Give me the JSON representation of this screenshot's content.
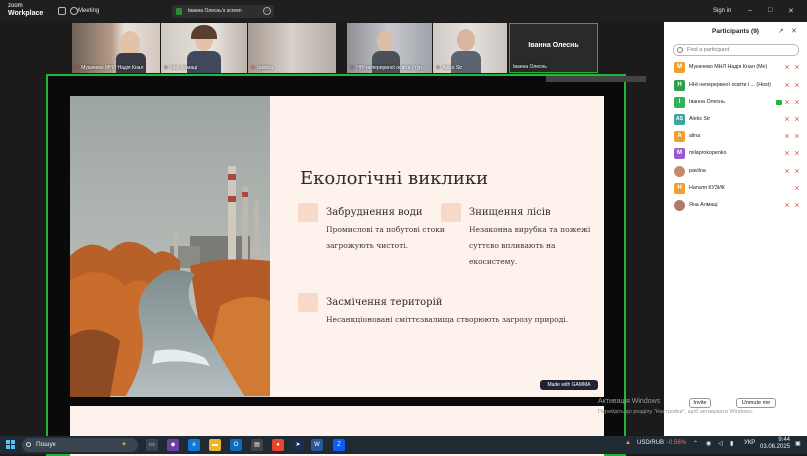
{
  "titlebar": {
    "logo_line1": "zoom",
    "logo_line2": "Workplace",
    "meeting_label": "Meeting",
    "screen_chip": "Іванна Олеснь's screen",
    "signin": "Sign in",
    "minimize": "–",
    "maximize": "□",
    "close": "✕"
  },
  "thumbnails": [
    {
      "name": "Мукачево МНЛ Надія Кнал"
    },
    {
      "name": "Яна Алмаці"
    },
    {
      "name": "pavlina"
    },
    {
      "name": "ННі неперервної освіти і тур..."
    },
    {
      "name": "Aleks Str"
    },
    {
      "name": "Іванна Олеснь",
      "active_label": "Іванна Олеснь"
    }
  ],
  "slide": {
    "title": "Екологічні виклики",
    "items": [
      {
        "head": "Забруднення води",
        "text1": "Промислові та побутові стоки",
        "text2": "загрожують чистоті."
      },
      {
        "head": "Знищення лісів",
        "text1": "Незаконна вирубка та пожежі",
        "text2": "суттєво впливають на",
        "text3": "екосистему."
      },
      {
        "head": "Засмічення територій",
        "text1": "Несанкціоновані сміттєзвалища створюють загрозу природі."
      }
    ],
    "made_with": "Made with GAMMA"
  },
  "panel": {
    "title": "Participants (9)",
    "search_placeholder": "Find a participant",
    "participants": [
      {
        "initial": "М",
        "name": "Мукачево МНЛ Надія Кнал (Me)",
        "color": "#f0a030"
      },
      {
        "initial": "Н",
        "name": "ННі неперервної освіти і ... (Host)",
        "color": "#2e9e4a"
      },
      {
        "initial": "І",
        "name": "Іванна Олеснь",
        "color": "#2fb35a"
      },
      {
        "initial": "AS",
        "name": "Aleks Str",
        "color": "#3aa6a0"
      },
      {
        "initial": "A",
        "name": "alina",
        "color": "#f0a030"
      },
      {
        "initial": "M",
        "name": "milaprokopenko",
        "color": "#9a5bd0"
      },
      {
        "initial": "",
        "name": "pavlina",
        "color": "#c48a6a"
      },
      {
        "initial": "Н",
        "name": "Наталя КУЗИК",
        "color": "#f0a030"
      },
      {
        "initial": "",
        "name": "Яна Алмаці",
        "color": "#b07a6a"
      }
    ],
    "invite": "Invite",
    "unmute_me": "Unmute me"
  },
  "watermark": {
    "line1": "Активація Windows",
    "line2": "Перейдіть до розділу \"Настройки\", щоб активувати Windows."
  },
  "taskbar": {
    "search": "Пошук",
    "currency": "USD/RUB",
    "change": "-0.56%",
    "lang": "УКР",
    "time": "9:44",
    "date": "03.06.2025"
  },
  "colors": {
    "active_border": "#24b33b",
    "muted": "#e03a3a"
  }
}
